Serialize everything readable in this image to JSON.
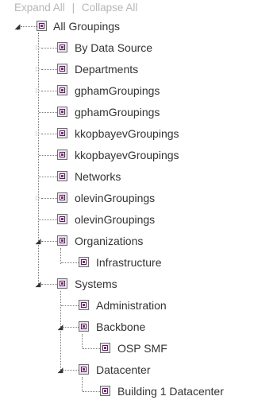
{
  "toolbar": {
    "expand_all": "Expand All",
    "separator": "|",
    "collapse_all": "Collapse All"
  },
  "tree": {
    "root": {
      "label": "All Groupings",
      "expanded": true
    },
    "children": [
      {
        "label": "By Data Source",
        "state": "collapsed"
      },
      {
        "label": "Departments",
        "state": "collapsed"
      },
      {
        "label": "gphamGroupings",
        "state": "collapsed"
      },
      {
        "label": "gphamGroupings",
        "state": "leaf"
      },
      {
        "label": "kkopbayevGroupings",
        "state": "collapsed"
      },
      {
        "label": "kkopbayevGroupings",
        "state": "leaf"
      },
      {
        "label": "Networks",
        "state": "leaf"
      },
      {
        "label": "olevinGroupings",
        "state": "collapsed"
      },
      {
        "label": "olevinGroupings",
        "state": "leaf"
      },
      {
        "label": "Organizations",
        "state": "expanded",
        "children": [
          {
            "label": "Infrastructure"
          }
        ]
      },
      {
        "label": "Systems",
        "state": "expanded",
        "children": [
          {
            "label": "Administration",
            "state": "leaf"
          },
          {
            "label": "Backbone",
            "state": "expanded",
            "children": [
              {
                "label": "OSP SMF"
              }
            ]
          },
          {
            "label": "Datacenter",
            "state": "expanded",
            "children": [
              {
                "label": "Building 1 Datacenter"
              }
            ]
          }
        ]
      }
    ]
  },
  "icons": {
    "expanded": "triangle-down-icon",
    "collapsed": "triangle-right-icon",
    "node": "grouping-icon"
  }
}
